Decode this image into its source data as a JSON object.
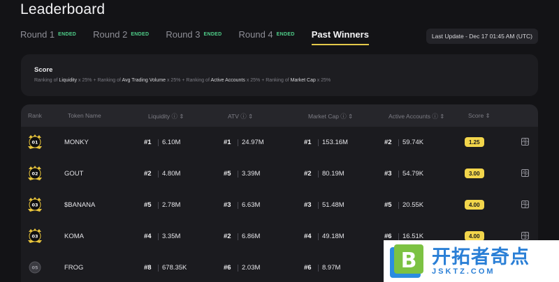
{
  "header": {
    "title": "Leaderboard"
  },
  "tabs": [
    {
      "label": "Round 1",
      "badge": "ENDED"
    },
    {
      "label": "Round 2",
      "badge": "ENDED"
    },
    {
      "label": "Round 3",
      "badge": "ENDED"
    },
    {
      "label": "Round 4",
      "badge": "ENDED"
    },
    {
      "label": "Past Winners",
      "badge": ""
    }
  ],
  "last_update": "Last Update - Dec 17 01:45 AM (UTC)",
  "score": {
    "title": "Score",
    "prefix1": "Ranking of ",
    "key1": "Liquidity",
    "mid1": " x 25% + Ranking of ",
    "key2": "Avg Trading Volume",
    "mid2": " x 25% + Ranking of ",
    "key3": "Active Accounts",
    "mid3": " x 25% + Ranking of ",
    "key4": "Market Cap",
    "suffix": " x  25%"
  },
  "table": {
    "headers": {
      "rank": "Rank",
      "token": "Token Name",
      "liquidity": "Liquidity ⓘ ⇕",
      "atv": "ATV ⓘ ⇕",
      "mcap": "Market Cap ⓘ ⇕",
      "accounts": "Active Accounts ⓘ ⇕",
      "score": "Score ⇕"
    },
    "rows": [
      {
        "rank_label": "01",
        "token": "MONKY",
        "liq_rank": "#1",
        "liq": "6.10M",
        "atv_rank": "#1",
        "atv": "24.97M",
        "mcap_rank": "#1",
        "mcap": "153.16M",
        "acc_rank": "#2",
        "acc": "59.74K",
        "score": "1.25"
      },
      {
        "rank_label": "02",
        "token": "GOUT",
        "liq_rank": "#2",
        "liq": "4.80M",
        "atv_rank": "#5",
        "atv": "3.39M",
        "mcap_rank": "#2",
        "mcap": "80.19M",
        "acc_rank": "#3",
        "acc": "54.79K",
        "score": "3.00"
      },
      {
        "rank_label": "03",
        "token": "$BANANA",
        "liq_rank": "#5",
        "liq": "2.78M",
        "atv_rank": "#3",
        "atv": "6.63M",
        "mcap_rank": "#3",
        "mcap": "51.48M",
        "acc_rank": "#5",
        "acc": "20.55K",
        "score": "4.00"
      },
      {
        "rank_label": "03",
        "token": "KOMA",
        "liq_rank": "#4",
        "liq": "3.35M",
        "atv_rank": "#2",
        "atv": "6.86M",
        "mcap_rank": "#4",
        "mcap": "49.18M",
        "acc_rank": "#6",
        "acc": "16.51K",
        "score": "4.00"
      },
      {
        "rank_label": "05",
        "token": "FROG",
        "liq_rank": "#8",
        "liq": "678.35K",
        "atv_rank": "#6",
        "atv": "2.03M",
        "mcap_rank": "#6",
        "mcap": "8.97M",
        "acc_rank": "",
        "acc": "",
        "score": ""
      }
    ]
  },
  "watermark": {
    "cn": "开拓者奇点",
    "en": "JSKTZ.COM",
    "logo_letter": "B"
  },
  "colors": {
    "accent": "#f2d54b",
    "badge": "#4fd08a",
    "watermark": "#2a7fd6"
  }
}
